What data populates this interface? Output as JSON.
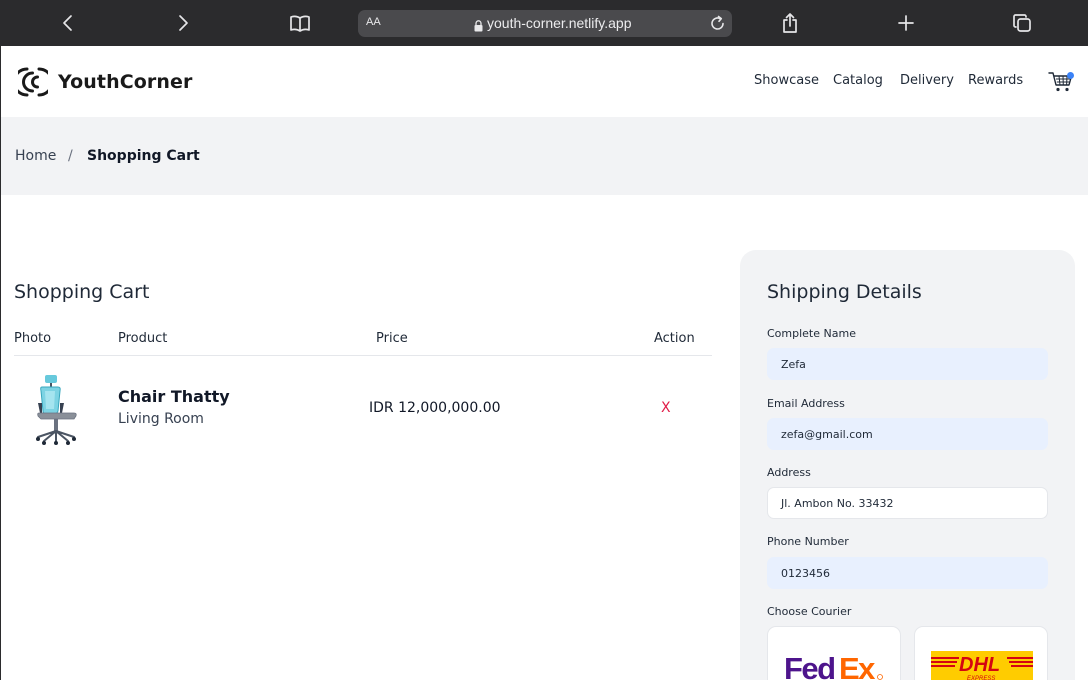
{
  "browser": {
    "text_size_label": "AA",
    "url": "youth-corner.netlify.app",
    "icons": [
      "back-icon",
      "forward-icon",
      "book-icon",
      "lock-icon",
      "reload-icon",
      "share-icon",
      "plus-icon",
      "tabs-icon"
    ]
  },
  "navbar": {
    "brand": "YouthCorner",
    "menu": [
      "Showcase",
      "Catalog",
      "Delivery",
      "Rewards"
    ],
    "cart_indicator_color": "#3b82f6"
  },
  "breadcrumb": {
    "home": "Home",
    "separator": "/",
    "current": "Shopping Cart"
  },
  "cart": {
    "title": "Shopping Cart",
    "columns": [
      "Photo",
      "Product",
      "Price",
      "Action"
    ],
    "items": [
      {
        "name": "Chair Thatty",
        "category": "Living Room",
        "price": "IDR 12,000,000.00",
        "action": "X"
      }
    ]
  },
  "shipping": {
    "title": "Shipping Details",
    "fields": {
      "name": {
        "label": "Complete Name",
        "value": "Zefa"
      },
      "email": {
        "label": "Email Address",
        "value": "zefa@gmail.com"
      },
      "address": {
        "label": "Address",
        "value": "Jl. Ambon No. 33432"
      },
      "phone": {
        "label": "Phone Number",
        "value": "0123456"
      }
    },
    "courier_label": "Choose Courier",
    "couriers": [
      "FedEx",
      "DHL"
    ]
  },
  "colors": {
    "chrome_bg": "#2b2b2d",
    "crumb_bg": "#f2f3f5",
    "autofill_bg": "#e8f0fe",
    "remove": "#e11d48"
  }
}
